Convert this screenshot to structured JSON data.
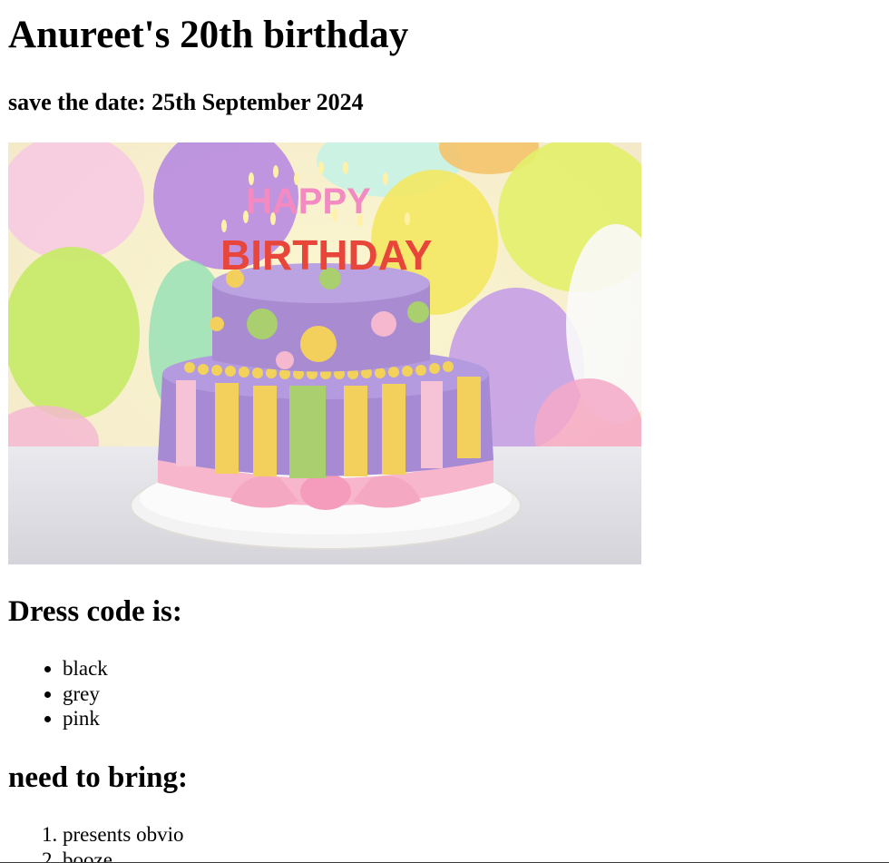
{
  "page": {
    "title": "Anureet's 20th birthday",
    "subtitle": "save the date: 25th September 2024",
    "image": {
      "alt": "birthday-cake-photo",
      "candle_text_top": "HAPPY",
      "candle_text_bottom": "BIRTHDAY",
      "colors": {
        "cake_purple": "#a98bd2",
        "cake_yellow": "#f3cf5b",
        "cake_green": "#a9cf6f",
        "cake_pink": "#f6b8cf",
        "plate_white": "#f1f1f1"
      }
    },
    "dress_code": {
      "heading": "Dress code is:",
      "items": [
        "black",
        "grey",
        "pink"
      ]
    },
    "bring": {
      "heading": "need to bring:",
      "items": [
        "presents obvio",
        "booze"
      ]
    }
  }
}
